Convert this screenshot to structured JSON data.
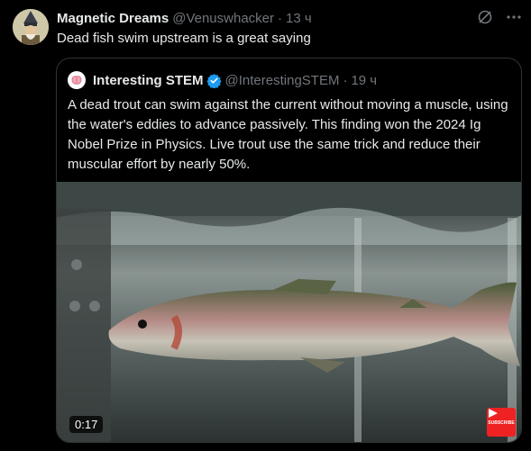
{
  "tweet": {
    "author_name": "Magnetic Dreams",
    "author_handle": "@Venuswhacker",
    "separator": "·",
    "time": "13 ч",
    "text": "Dead fish swim upstream is a great saying",
    "icons": [
      "grok-icon",
      "more-icon"
    ]
  },
  "quoted": {
    "author_name": "Interesting STEM",
    "author_handle": "@InterestingSTEM",
    "separator": "·",
    "time": "19 ч",
    "text": "A dead trout can swim against the current without moving a muscle, using the water's eddies to advance passively. This finding won the 2024 Ig Nobel Prize in Physics. Live trout use the same trick and reduce their muscular effort by nearly 50%.",
    "video": {
      "duration": "0:17",
      "subscribe_label": "SUBSCRIBE"
    }
  },
  "colors": {
    "background": "#000000",
    "text": "#e7e9ea",
    "muted": "#71767b",
    "border": "#2f3336",
    "verified": "#1d9bf0"
  }
}
